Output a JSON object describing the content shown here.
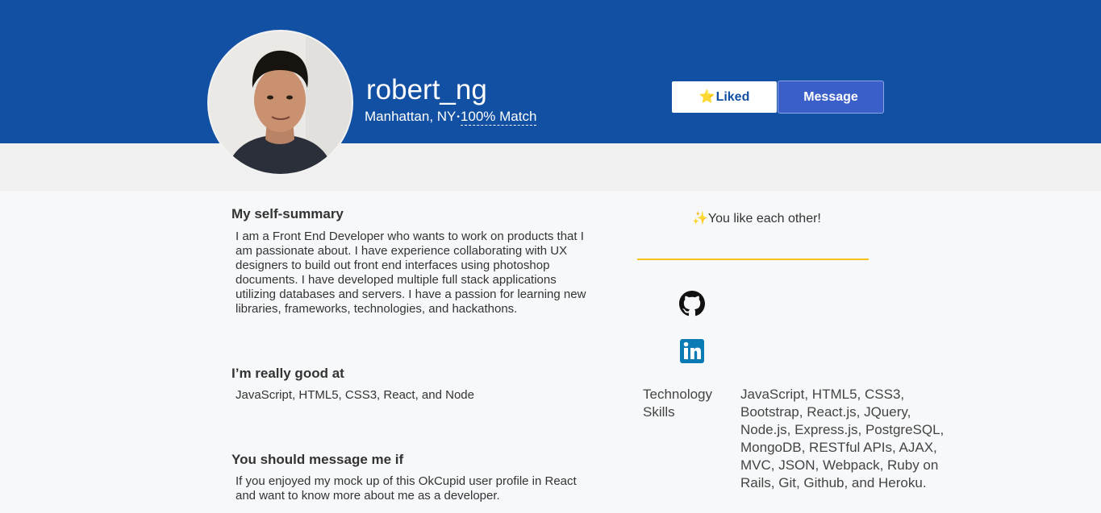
{
  "profile": {
    "username": "robert_ng",
    "location": "Manhattan, NY",
    "separator": "•",
    "match": "100% Match"
  },
  "actions": {
    "like_icon": "⭐",
    "like_label": "Liked",
    "message_label": "Message"
  },
  "sections": [
    {
      "title": "My self-summary",
      "text": "I am a Front End Developer who wants to work on products that I am passionate about. I have experience collaborating with UX designers to build out front end interfaces using photoshop documents. I have developed multiple full stack applications utilizing databases and servers. I have a passion for learning new libraries, frameworks, technologies, and hackathons."
    },
    {
      "title": "I’m really good at",
      "text": "JavaScript, HTML5, CSS3, React, and Node"
    },
    {
      "title": "You should message me if",
      "text": "If you enjoyed my mock up of this OkCupid user profile in React and want to know more about me as a developer."
    }
  ],
  "sidebar": {
    "mutual_icon": "✨",
    "mutual_text": "You like each other!",
    "links": [
      {
        "icon": "github-icon"
      },
      {
        "icon": "linkedin-icon"
      }
    ],
    "tech_label": "Technology Skills",
    "tech_value": "JavaScript, HTML5, CSS3, Bootstrap, React.js, JQuery, Node.js, Express.js, PostgreSQL, MongoDB, RESTful APIs, AJAX, MVC, JSON, Webpack, Ruby on Rails, Git, Github, and Heroku."
  },
  "colors": {
    "header_bg": "#1250a3",
    "message_button": "#3b5fc9",
    "divider": "#f5c31c",
    "linkedin": "#0a7bb5"
  }
}
